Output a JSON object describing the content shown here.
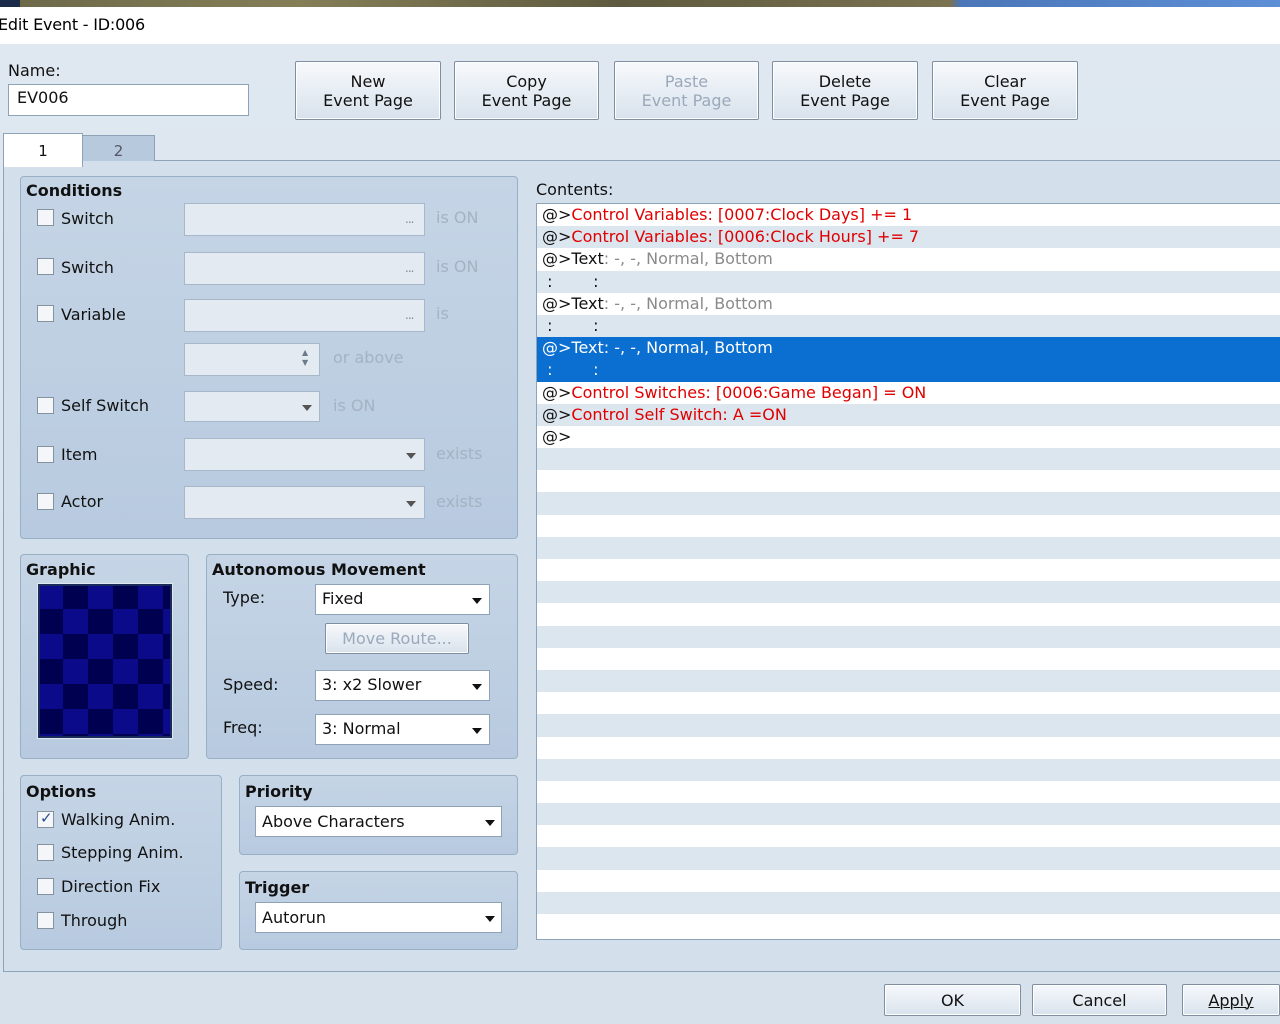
{
  "window": {
    "title": "Edit Event - ID:006"
  },
  "name": {
    "label": "Name:",
    "value": "EV006"
  },
  "toolbar": [
    {
      "line1": "New",
      "line2": "Event Page",
      "enabled": true
    },
    {
      "line1": "Copy",
      "line2": "Event Page",
      "enabled": true
    },
    {
      "line1": "Paste",
      "line2": "Event Page",
      "enabled": false
    },
    {
      "line1": "Delete",
      "line2": "Event Page",
      "enabled": true
    },
    {
      "line1": "Clear",
      "line2": "Event Page",
      "enabled": true
    }
  ],
  "tabs": [
    {
      "label": "1",
      "active": true
    },
    {
      "label": "2",
      "active": false
    }
  ],
  "conditions": {
    "title": "Conditions",
    "switch1": {
      "label": "Switch",
      "suffix": "is ON",
      "dots": "...",
      "checked": false
    },
    "switch2": {
      "label": "Switch",
      "suffix": "is ON",
      "dots": "...",
      "checked": false
    },
    "variable": {
      "label": "Variable",
      "suffix": "is",
      "dots": "...",
      "value_suffix": "or above",
      "checked": false
    },
    "self_switch": {
      "label": "Self Switch",
      "suffix": "is ON",
      "checked": false
    },
    "item": {
      "label": "Item",
      "suffix": "exists",
      "checked": false
    },
    "actor": {
      "label": "Actor",
      "suffix": "exists",
      "checked": false
    }
  },
  "graphic": {
    "title": "Graphic"
  },
  "movement": {
    "title": "Autonomous Movement",
    "type_label": "Type:",
    "type_value": "Fixed",
    "move_route": "Move Route...",
    "speed_label": "Speed:",
    "speed_value": "3: x2 Slower",
    "freq_label": "Freq:",
    "freq_value": "3: Normal"
  },
  "options": {
    "title": "Options",
    "items": [
      {
        "label": "Walking Anim.",
        "checked": true
      },
      {
        "label": "Stepping Anim.",
        "checked": false
      },
      {
        "label": "Direction Fix",
        "checked": false
      },
      {
        "label": "Through",
        "checked": false
      }
    ]
  },
  "priority": {
    "title": "Priority",
    "value": "Above Characters"
  },
  "trigger": {
    "title": "Trigger",
    "value": "Autorun"
  },
  "contents": {
    "label": "Contents:",
    "rows": [
      {
        "prefix": "@>",
        "cmd": "Control Variables: [0007:Clock Days] += 1",
        "style": "red",
        "selected": false
      },
      {
        "prefix": "@>",
        "cmd": "Control Variables: [0006:Clock Hours] += 7",
        "style": "red",
        "selected": false
      },
      {
        "prefix": "@>Text",
        "cmd": ": -, -, Normal, Bottom",
        "style": "gray",
        "selected": false
      },
      {
        "prefix": " :        :",
        "cmd": "",
        "style": "plain",
        "selected": false
      },
      {
        "prefix": "@>Text",
        "cmd": ": -, -, Normal, Bottom",
        "style": "gray",
        "selected": false
      },
      {
        "prefix": " :        :",
        "cmd": "",
        "style": "plain",
        "selected": false
      },
      {
        "prefix": "@>Text",
        "cmd": ": -, -, Normal, Bottom",
        "style": "gray",
        "selected": true
      },
      {
        "prefix": " :        :",
        "cmd": "",
        "style": "plain",
        "selected": true
      },
      {
        "prefix": "@>",
        "cmd": "Control Switches: [0006:Game Began] = ON",
        "style": "red",
        "selected": false
      },
      {
        "prefix": "@>",
        "cmd": "Control Self Switch: A =ON",
        "style": "red",
        "selected": false
      },
      {
        "prefix": "@>",
        "cmd": "",
        "style": "plain",
        "selected": false
      }
    ]
  },
  "footer": {
    "ok": "OK",
    "cancel": "Cancel",
    "apply": "Apply"
  }
}
